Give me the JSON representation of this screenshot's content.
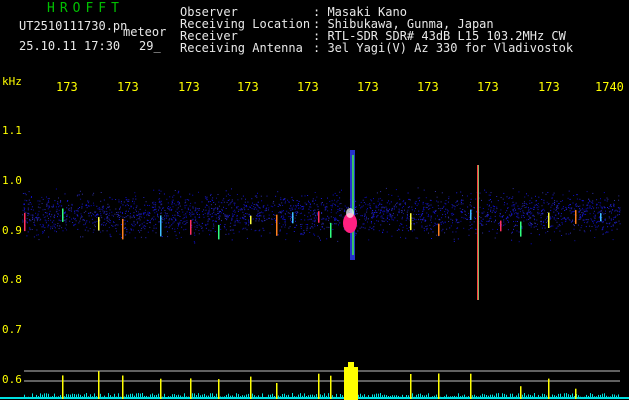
{
  "header": {
    "title": "HROFFT",
    "filename": "UT2510111730.pn",
    "meteor_label": "meteor",
    "timestamp": "25.10.11 17:30",
    "count": "29_"
  },
  "info": [
    {
      "label": "Observer",
      "value": ": Masaki Kano"
    },
    {
      "label": "Receiving Location",
      "value": ": Shibukawa, Gunma, Japan"
    },
    {
      "label": "Receiver",
      "value": ": RTL-SDR SDR# 43dB L15 103.2MHz CW"
    },
    {
      "label": "Receiving Antenna",
      "value": ": 3el Yagi(V) Az 330 for Vladivostok"
    }
  ],
  "axis": {
    "unit": "kHz",
    "x_ticks": [
      "173",
      "173",
      "173",
      "173",
      "173",
      "173",
      "173",
      "173",
      "173",
      "1740"
    ],
    "y_ticks": [
      "1.1",
      "1.0",
      "0.9",
      "0.8",
      "0.7",
      "0.6"
    ]
  },
  "colors": {
    "background": "#000000",
    "title": "#00c000",
    "text": "#e8e8e8",
    "axis_labels": "#ffff00",
    "noise": "#1a1ab0",
    "meteor": "#ff2080",
    "histogram": "#ffff00",
    "baseline": "#00e0e0"
  }
}
